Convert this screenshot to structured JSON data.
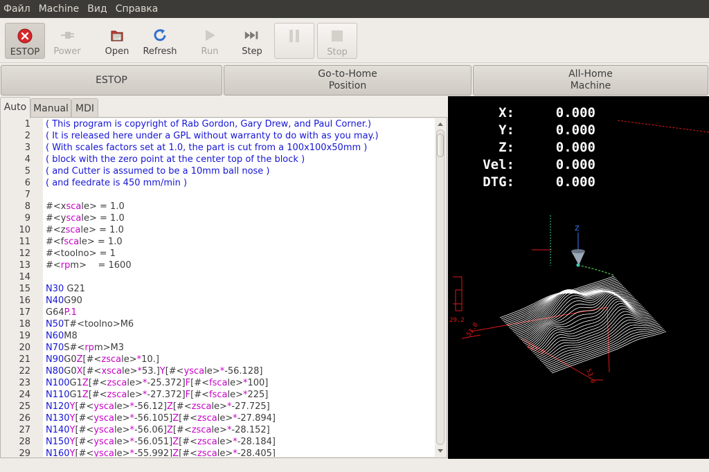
{
  "menubar": [
    "Файл",
    "Machine",
    "Вид",
    "Справка"
  ],
  "toolbar": {
    "estop": "ESTOP",
    "power": "Power",
    "open": "Open",
    "refresh": "Refresh",
    "run": "Run",
    "step": "Step",
    "stop": "Stop"
  },
  "big_buttons": {
    "estop": "ESTOP",
    "goto_home_1": "Go-to-Home",
    "goto_home_2": "Position",
    "all_home_1": "All-Home",
    "all_home_2": "Machine"
  },
  "tabs": [
    "Auto",
    "Manual",
    "MDI"
  ],
  "editor": {
    "lines": [
      [
        {
          "t": "( This program is copyright of Rab Gordon, Gary Drew, and Paul Corner.)",
          "c": "comment"
        }
      ],
      [
        {
          "t": "( It is released here under a GPL without warranty to do with as you may.)",
          "c": "comment"
        }
      ],
      [
        {
          "t": "( With scales factors set at 1.0, the part is cut from a 100x100x50mm )",
          "c": "comment"
        }
      ],
      [
        {
          "t": "( block with the zero point at the center top of the block )",
          "c": "comment"
        }
      ],
      [
        {
          "t": "( and Cutter is assumed to be a 10mm ball nose )",
          "c": "comment"
        }
      ],
      [
        {
          "t": "( and feedrate is 450 mm/min )",
          "c": "comment"
        }
      ],
      [],
      [
        {
          "t": "#<",
          "c": "txt"
        },
        {
          "t": "x",
          "c": "txt"
        },
        {
          "t": "sca",
          "c": "var"
        },
        {
          "t": "le> = 1.0",
          "c": "txt"
        }
      ],
      [
        {
          "t": "#<",
          "c": "txt"
        },
        {
          "t": "y",
          "c": "txt"
        },
        {
          "t": "sca",
          "c": "var"
        },
        {
          "t": "le> = 1.0",
          "c": "txt"
        }
      ],
      [
        {
          "t": "#<",
          "c": "txt"
        },
        {
          "t": "z",
          "c": "txt"
        },
        {
          "t": "sca",
          "c": "var"
        },
        {
          "t": "le> = 1.0",
          "c": "txt"
        }
      ],
      [
        {
          "t": "#<",
          "c": "txt"
        },
        {
          "t": "f",
          "c": "txt"
        },
        {
          "t": "sca",
          "c": "var"
        },
        {
          "t": "le> = 1.0",
          "c": "txt"
        }
      ],
      [
        {
          "t": "#<toolno> = 1",
          "c": "txt"
        }
      ],
      [
        {
          "t": "#<",
          "c": "txt"
        },
        {
          "t": "rp",
          "c": "var"
        },
        {
          "t": "m>    = 1600",
          "c": "txt"
        }
      ],
      [],
      [
        {
          "t": "N30",
          "c": "key"
        },
        {
          "t": " G21",
          "c": "txt"
        }
      ],
      [
        {
          "t": "N40",
          "c": "key"
        },
        {
          "t": "G90",
          "c": "txt"
        }
      ],
      [
        {
          "t": "G64",
          "c": "txt"
        },
        {
          "t": "P.1",
          "c": "var"
        }
      ],
      [
        {
          "t": "N50",
          "c": "key"
        },
        {
          "t": "T#<toolno>M6",
          "c": "txt"
        }
      ],
      [
        {
          "t": "N60",
          "c": "key"
        },
        {
          "t": "M8",
          "c": "txt"
        }
      ],
      [
        {
          "t": "N70",
          "c": "key"
        },
        {
          "t": "S#<",
          "c": "txt"
        },
        {
          "t": "rp",
          "c": "var"
        },
        {
          "t": "m>M3",
          "c": "txt"
        }
      ],
      [
        {
          "t": "N90",
          "c": "key"
        },
        {
          "t": "G0",
          "c": "txt"
        },
        {
          "t": "Z",
          "c": "var"
        },
        {
          "t": "[#<",
          "c": "txt"
        },
        {
          "t": "zsca",
          "c": "var"
        },
        {
          "t": "le>",
          "c": "txt"
        },
        {
          "t": "*",
          "c": "var"
        },
        {
          "t": "10.]",
          "c": "txt"
        }
      ],
      [
        {
          "t": "N80",
          "c": "key"
        },
        {
          "t": "G0",
          "c": "txt"
        },
        {
          "t": "X",
          "c": "var"
        },
        {
          "t": "[#<",
          "c": "txt"
        },
        {
          "t": "xsca",
          "c": "var"
        },
        {
          "t": "le>",
          "c": "txt"
        },
        {
          "t": "*",
          "c": "var"
        },
        {
          "t": "53.]",
          "c": "txt"
        },
        {
          "t": "Y",
          "c": "var"
        },
        {
          "t": "[#<",
          "c": "txt"
        },
        {
          "t": "ysca",
          "c": "var"
        },
        {
          "t": "le>",
          "c": "txt"
        },
        {
          "t": "*",
          "c": "var"
        },
        {
          "t": "-56.128]",
          "c": "txt"
        }
      ],
      [
        {
          "t": "N100",
          "c": "key"
        },
        {
          "t": "G1",
          "c": "txt"
        },
        {
          "t": "Z",
          "c": "var"
        },
        {
          "t": "[#<",
          "c": "txt"
        },
        {
          "t": "zsca",
          "c": "var"
        },
        {
          "t": "le>",
          "c": "txt"
        },
        {
          "t": "*",
          "c": "var"
        },
        {
          "t": "-25.372]",
          "c": "txt"
        },
        {
          "t": "F",
          "c": "var"
        },
        {
          "t": "[#<",
          "c": "txt"
        },
        {
          "t": "fsca",
          "c": "var"
        },
        {
          "t": "le>",
          "c": "txt"
        },
        {
          "t": "*",
          "c": "var"
        },
        {
          "t": "100]",
          "c": "txt"
        }
      ],
      [
        {
          "t": "N110",
          "c": "key"
        },
        {
          "t": "G1",
          "c": "txt"
        },
        {
          "t": "Z",
          "c": "var"
        },
        {
          "t": "[#<",
          "c": "txt"
        },
        {
          "t": "zsca",
          "c": "var"
        },
        {
          "t": "le>",
          "c": "txt"
        },
        {
          "t": "*",
          "c": "var"
        },
        {
          "t": "-27.372]",
          "c": "txt"
        },
        {
          "t": "F",
          "c": "var"
        },
        {
          "t": "[#<",
          "c": "txt"
        },
        {
          "t": "fsca",
          "c": "var"
        },
        {
          "t": "le>",
          "c": "txt"
        },
        {
          "t": "*",
          "c": "var"
        },
        {
          "t": "225]",
          "c": "txt"
        }
      ],
      [
        {
          "t": "N120",
          "c": "key"
        },
        {
          "t": "Y",
          "c": "var"
        },
        {
          "t": "[#<",
          "c": "txt"
        },
        {
          "t": "ysca",
          "c": "var"
        },
        {
          "t": "le>",
          "c": "txt"
        },
        {
          "t": "*",
          "c": "var"
        },
        {
          "t": "-56.12]",
          "c": "txt"
        },
        {
          "t": "Z",
          "c": "var"
        },
        {
          "t": "[#<",
          "c": "txt"
        },
        {
          "t": "zsca",
          "c": "var"
        },
        {
          "t": "le>",
          "c": "txt"
        },
        {
          "t": "*",
          "c": "var"
        },
        {
          "t": "-27.725]",
          "c": "txt"
        }
      ],
      [
        {
          "t": "N130",
          "c": "key"
        },
        {
          "t": "Y",
          "c": "var"
        },
        {
          "t": "[#<",
          "c": "txt"
        },
        {
          "t": "ysca",
          "c": "var"
        },
        {
          "t": "le>",
          "c": "txt"
        },
        {
          "t": "*",
          "c": "var"
        },
        {
          "t": "-56.105]",
          "c": "txt"
        },
        {
          "t": "Z",
          "c": "var"
        },
        {
          "t": "[#<",
          "c": "txt"
        },
        {
          "t": "zsca",
          "c": "var"
        },
        {
          "t": "le>",
          "c": "txt"
        },
        {
          "t": "*",
          "c": "var"
        },
        {
          "t": "-27.894]",
          "c": "txt"
        }
      ],
      [
        {
          "t": "N140",
          "c": "key"
        },
        {
          "t": "Y",
          "c": "var"
        },
        {
          "t": "[#<",
          "c": "txt"
        },
        {
          "t": "ysca",
          "c": "var"
        },
        {
          "t": "le>",
          "c": "txt"
        },
        {
          "t": "*",
          "c": "var"
        },
        {
          "t": "-56.06]",
          "c": "txt"
        },
        {
          "t": "Z",
          "c": "var"
        },
        {
          "t": "[#<",
          "c": "txt"
        },
        {
          "t": "zsca",
          "c": "var"
        },
        {
          "t": "le>",
          "c": "txt"
        },
        {
          "t": "*",
          "c": "var"
        },
        {
          "t": "-28.152]",
          "c": "txt"
        }
      ],
      [
        {
          "t": "N150",
          "c": "key"
        },
        {
          "t": "Y",
          "c": "var"
        },
        {
          "t": "[#<",
          "c": "txt"
        },
        {
          "t": "ysca",
          "c": "var"
        },
        {
          "t": "le>",
          "c": "txt"
        },
        {
          "t": "*",
          "c": "var"
        },
        {
          "t": "-56.051]",
          "c": "txt"
        },
        {
          "t": "Z",
          "c": "var"
        },
        {
          "t": "[#<",
          "c": "txt"
        },
        {
          "t": "zsca",
          "c": "var"
        },
        {
          "t": "le>",
          "c": "txt"
        },
        {
          "t": "*",
          "c": "var"
        },
        {
          "t": "-28.184]",
          "c": "txt"
        }
      ],
      [
        {
          "t": "N160",
          "c": "key"
        },
        {
          "t": "Y",
          "c": "var"
        },
        {
          "t": "[#<",
          "c": "txt"
        },
        {
          "t": "ysca",
          "c": "var"
        },
        {
          "t": "le>",
          "c": "txt"
        },
        {
          "t": "*",
          "c": "var"
        },
        {
          "t": "-55.992]",
          "c": "txt"
        },
        {
          "t": "Z",
          "c": "var"
        },
        {
          "t": "[#<",
          "c": "txt"
        },
        {
          "t": "zsca",
          "c": "var"
        },
        {
          "t": "le>",
          "c": "txt"
        },
        {
          "t": "*",
          "c": "var"
        },
        {
          "t": "-28.405]",
          "c": "txt"
        }
      ]
    ],
    "first_line_number": 1
  },
  "dro": [
    {
      "label": "X:",
      "value": "0.000"
    },
    {
      "label": "Y:",
      "value": "0.000"
    },
    {
      "label": "Z:",
      "value": "0.000"
    },
    {
      "label": "Vel:",
      "value": "0.000"
    },
    {
      "label": "DTG:",
      "value": "0.000"
    }
  ],
  "preview_dims": {
    "x_extent": "103.0",
    "y_extent": "53.0",
    "z_extent": "29.2",
    "x_min": "-53.0",
    "axis_z_label": "Z"
  },
  "colors": {
    "comment": "#1515d6",
    "keyword": "#1515d6",
    "variable": "#c800c8",
    "toolpath": "#ffffff",
    "dimension": "#e01818",
    "rapid": "#4aa84a",
    "axis": "#3c7cff",
    "tool": "#9aa8b8"
  }
}
